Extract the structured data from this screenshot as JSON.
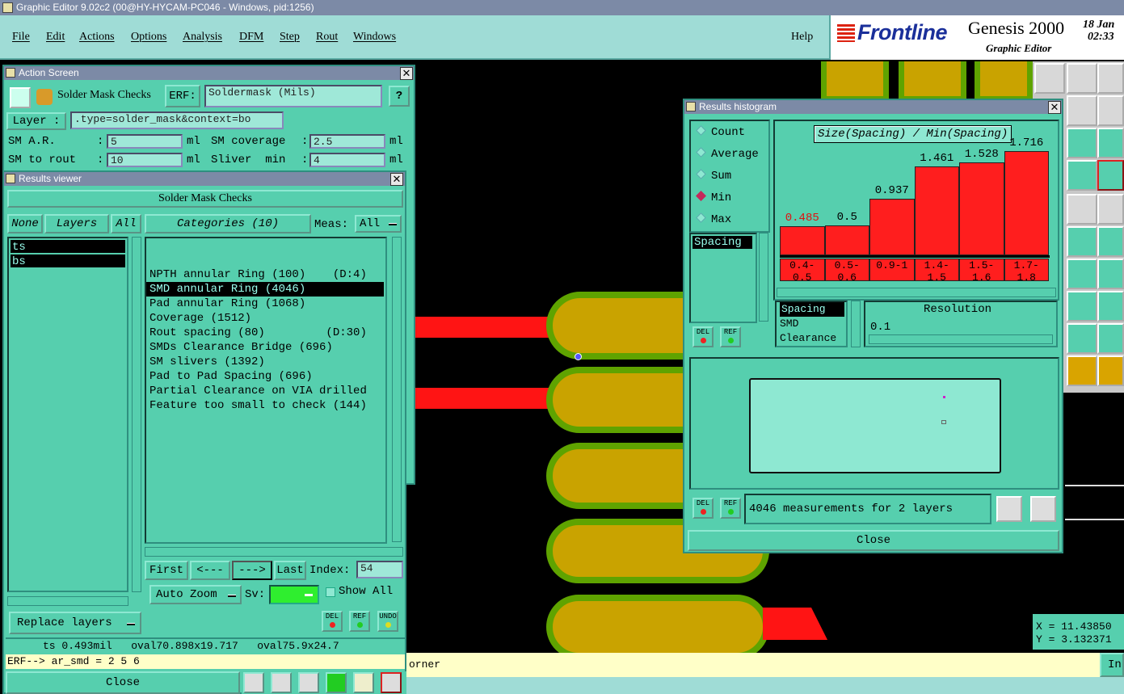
{
  "window_title": "Graphic Editor 9.02c2 (00@HY-HYCAM-PC046 - Windows, pid:1256)",
  "menu": [
    "File",
    "Edit",
    "Actions",
    "Options",
    "Analysis",
    "DFM",
    "Step",
    "Rout",
    "Windows"
  ],
  "help_label": "Help",
  "brand": {
    "logo": "Frontline",
    "product": "Genesis 2000",
    "subtitle": "Graphic Editor",
    "date_line1": "18 Jan",
    "date_line2": "02:33"
  },
  "action_screen": {
    "title": "Action Screen",
    "check_name": "Solder Mask Checks",
    "erf_label": "ERF:",
    "erf_value": "Soldermask (Mils)",
    "help": "?",
    "layer_label": "Layer :",
    "layer_value": ".type=solder_mask&context=bo",
    "params": [
      {
        "label": "SM A.R.",
        "value": "5",
        "unit": "ml"
      },
      {
        "label": "SM coverage",
        "value": "2.5",
        "unit": "ml"
      },
      {
        "label": "SM to rout",
        "value": "10",
        "unit": "ml"
      },
      {
        "label": "Sliver  min",
        "value": "4",
        "unit": "ml"
      }
    ]
  },
  "results_viewer": {
    "title": "Results viewer",
    "header": "Solder Mask Checks",
    "none_btn": "None",
    "layers_btn": "Layers",
    "all_btn": "All",
    "categories_label": "Categories (10)",
    "meas_label": "Meas:",
    "meas_value": "All",
    "layers": [
      "ts",
      "bs"
    ],
    "categories": [
      "NPTH annular Ring (100)    (D:4)",
      "SMD annular Ring (4046)",
      "Pad annular Ring (1068)",
      "Coverage (1512)",
      "Rout spacing (80)         (D:30)",
      "SMDs Clearance Bridge (696)",
      "SM slivers (1392)",
      "Pad to Pad Spacing (696)",
      "Partial Clearance on VIA drilled",
      "Feature too small to check (144)"
    ],
    "selected_category": 1,
    "nav": {
      "first": "First",
      "prev": "<---",
      "next": "--->",
      "last": "Last",
      "index_label": "Index:",
      "index_value": "54"
    },
    "auto_zoom": "Auto Zoom",
    "sv_label": "Sv:",
    "show_all": "Show All",
    "replace_layers": "Replace layers",
    "del": "DEL",
    "ref": "REF",
    "undo": "UNDO",
    "status_line": "ts 0.493mil   oval70.898x19.717   oval75.9x24.7",
    "erf_line": "ERF--> ar_smd = 2 5 6",
    "close": "Close"
  },
  "histogram": {
    "title": "Results histogram",
    "modes": [
      "Count",
      "Average",
      "Sum",
      "Min",
      "Max"
    ],
    "selected_mode": "Min",
    "spacing_item": "Spacing",
    "chart_title": "Size(Spacing) / Min(Spacing)",
    "bars": [
      {
        "range": "0.4-0.5",
        "value": 0.485,
        "label": "0.485",
        "highlight": true
      },
      {
        "range": "0.5-0.6",
        "value": 0.5,
        "label": "0.5",
        "highlight": false
      },
      {
        "range": "0.9-1",
        "value": 0.937,
        "label": "0.937",
        "highlight": false
      },
      {
        "range": "1.4-1.5",
        "value": 1.461,
        "label": "1.461",
        "highlight": false
      },
      {
        "range": "1.5-1.6",
        "value": 1.528,
        "label": "1.528",
        "highlight": false
      },
      {
        "range": "1.7-1.8",
        "value": 1.716,
        "label": "1.716",
        "highlight": false
      }
    ],
    "measure_list": [
      "Spacing",
      "SMD",
      "Clearance"
    ],
    "resolution_label": "Resolution",
    "resolution_value": "0.1",
    "status": "4046 measurements for 2 layers",
    "close": "Close",
    "del": "DEL",
    "ref": "REF"
  },
  "coords": {
    "x": "X = 11.43850",
    "y": "Y = 3.132371"
  },
  "bottom_message": "orner",
  "bottom_right_btn": "In"
}
